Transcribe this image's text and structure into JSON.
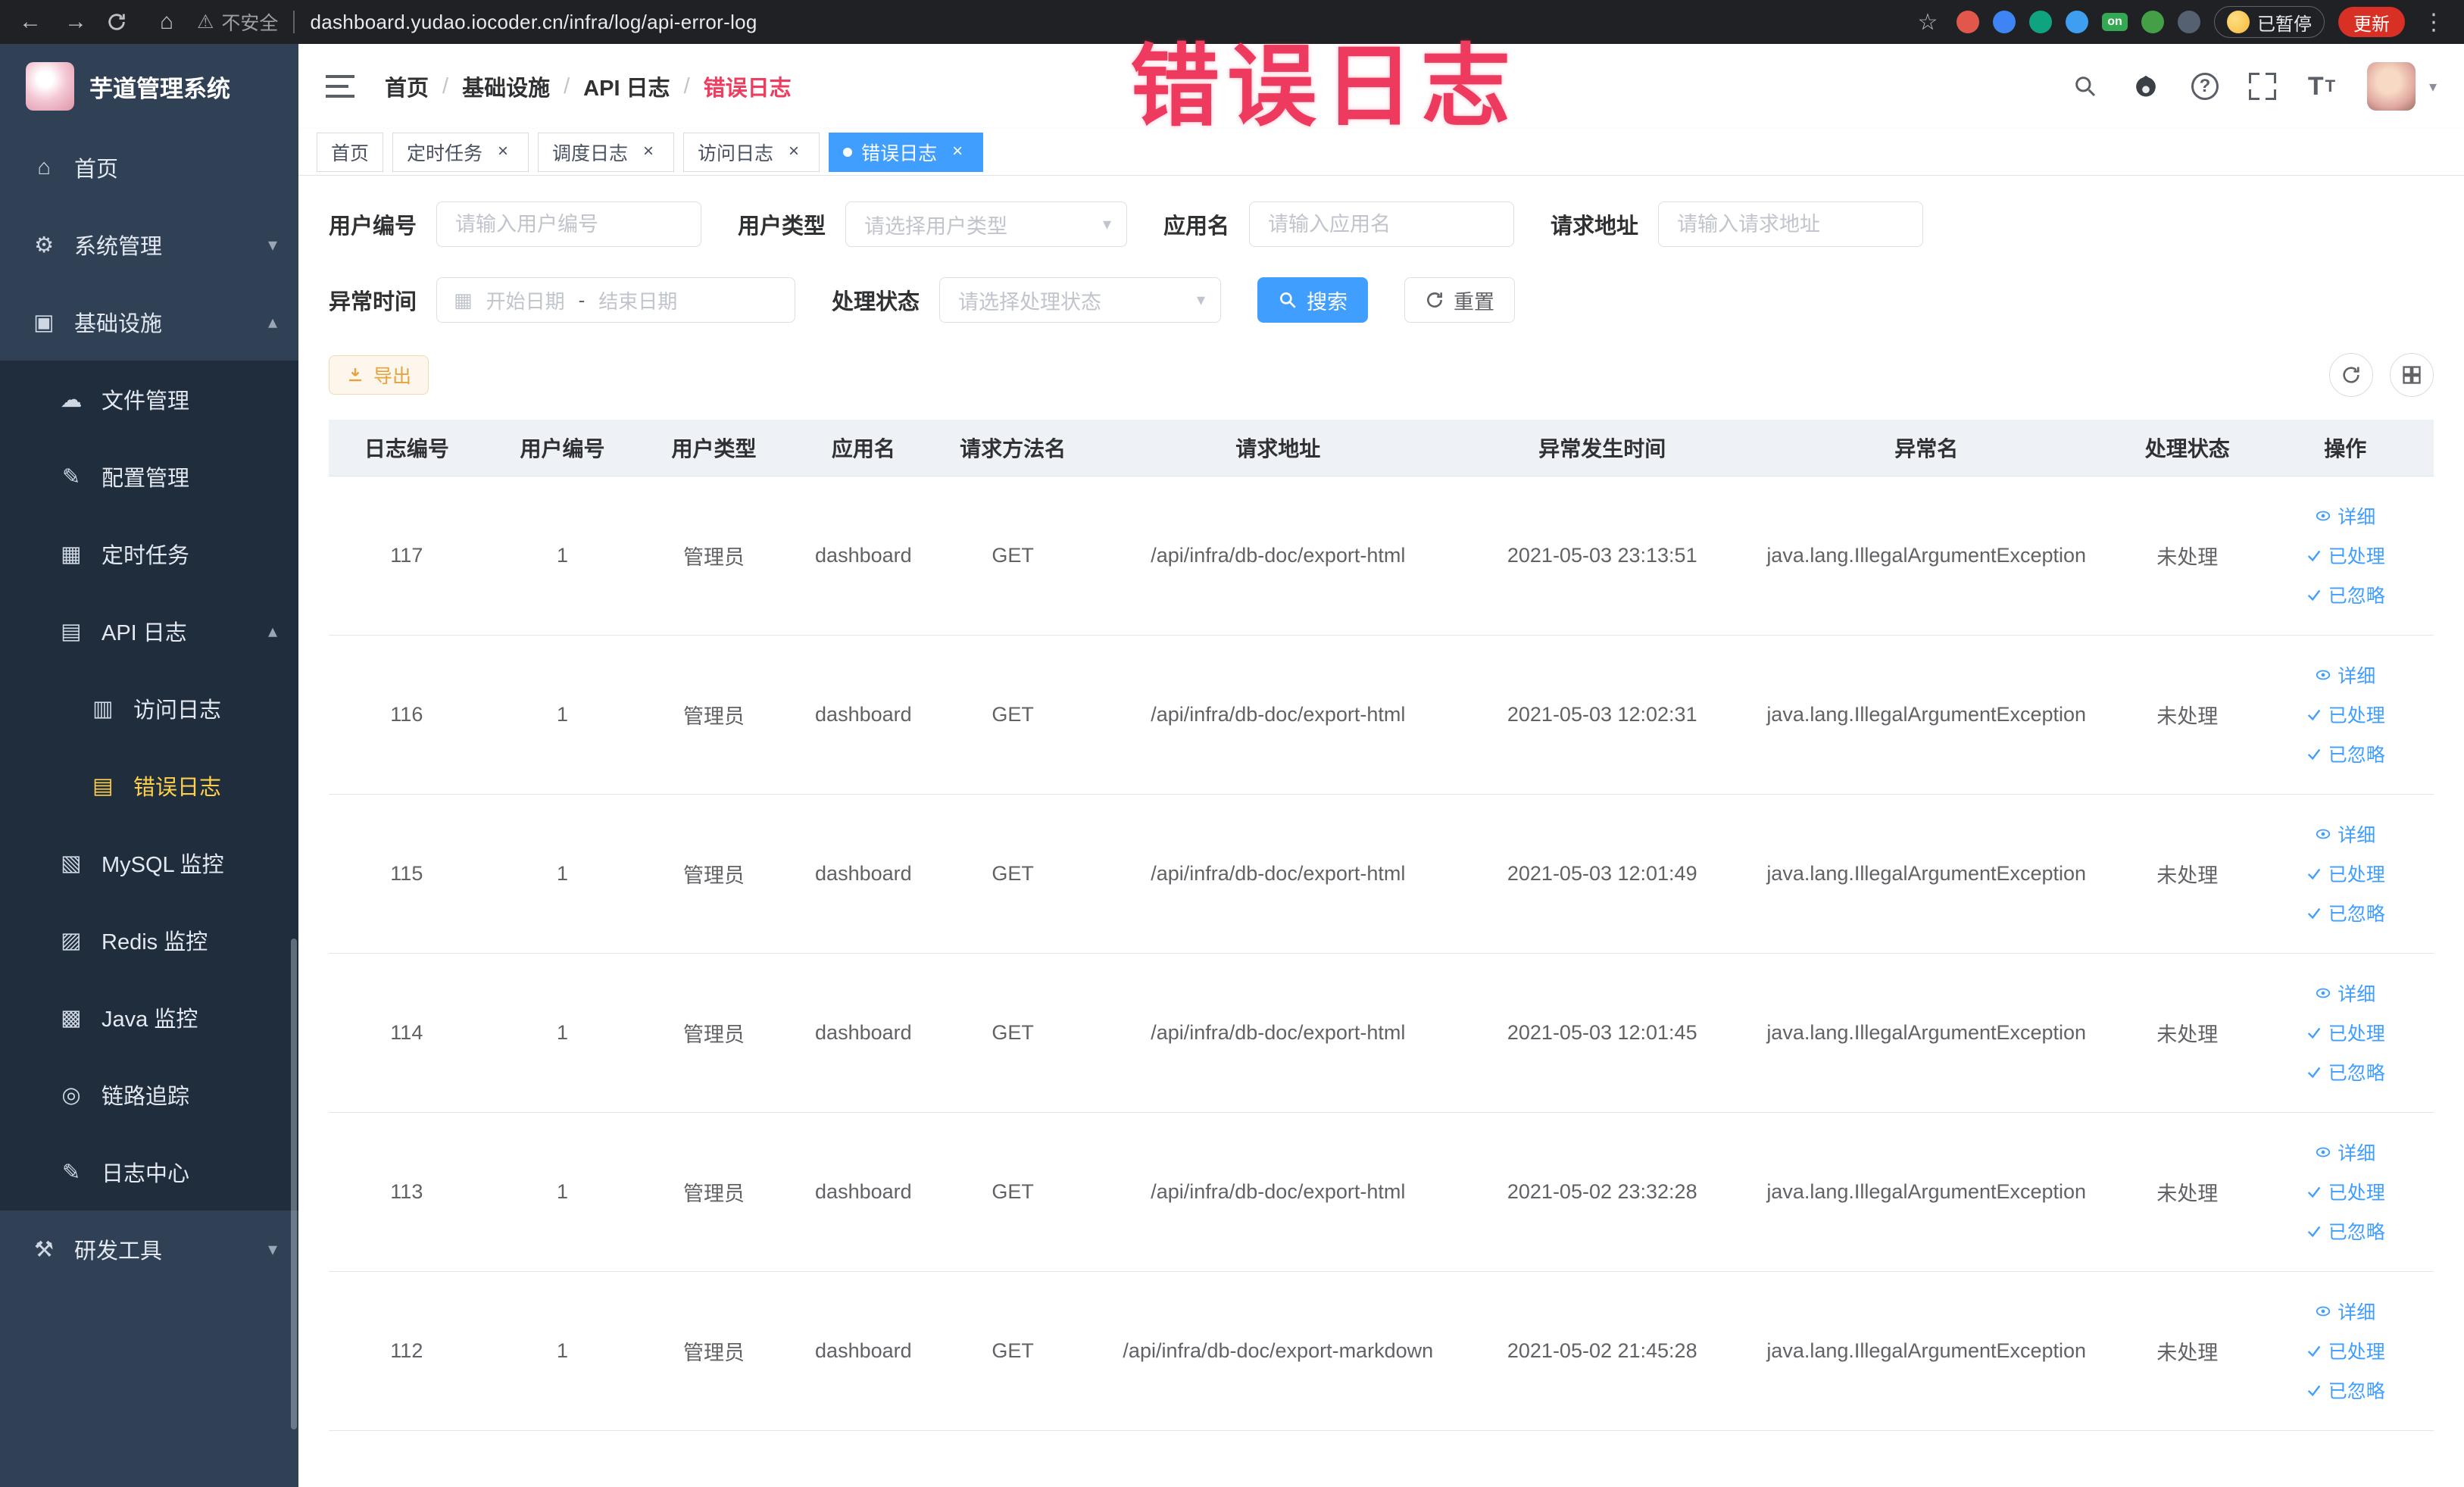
{
  "browser": {
    "security_label": "不安全",
    "url": "dashboard.yudao.iocoder.cn/infra/log/api-error-log",
    "paused_label": "已暂停",
    "update_label": "更新",
    "on_badge": "on"
  },
  "icons": {
    "back": "←",
    "forward": "→",
    "home_chrome": "⌂",
    "warning": "⚠",
    "star": "☆",
    "kebab": "⋮",
    "chevron_down": "▾",
    "chevron_up": "▴",
    "breadcrumb_sep": "/",
    "close": "×",
    "caret_down": "▾",
    "calendar": "▦",
    "question": "?",
    "font_size_large": "T",
    "font_size_small": "T",
    "home": "⌂",
    "system": "⚙",
    "infra": "▣",
    "file": "☁",
    "config": "✎",
    "job": "▦",
    "api_log": "▤",
    "access_log": "▥",
    "error_log": "▤",
    "mysql": "▧",
    "redis": "▨",
    "java": "▩",
    "trace": "◎",
    "log_center": "✎",
    "devtools": "⚒"
  },
  "annotation": {
    "title": "错误日志"
  },
  "sidebar": {
    "logo_title": "芋道管理系统",
    "home": "首页",
    "system": "系统管理",
    "infra": "基础设施",
    "file": "文件管理",
    "config": "配置管理",
    "job": "定时任务",
    "api_log": "API 日志",
    "access_log": "访问日志",
    "error_log": "错误日志",
    "mysql": "MySQL 监控",
    "redis": "Redis 监控",
    "java": "Java 监控",
    "trace": "链路追踪",
    "log_center": "日志中心",
    "devtools": "研发工具"
  },
  "breadcrumb": {
    "items": [
      "首页",
      "基础设施",
      "API 日志",
      "错误日志"
    ]
  },
  "tags": [
    {
      "label": "首页"
    },
    {
      "label": "定时任务"
    },
    {
      "label": "调度日志"
    },
    {
      "label": "访问日志"
    },
    {
      "label": "错误日志"
    }
  ],
  "filters": {
    "user_id": {
      "label": "用户编号",
      "placeholder": "请输入用户编号"
    },
    "user_type": {
      "label": "用户类型",
      "placeholder": "请选择用户类型"
    },
    "app_name": {
      "label": "应用名",
      "placeholder": "请输入应用名"
    },
    "request_url": {
      "label": "请求地址",
      "placeholder": "请输入请求地址"
    },
    "exception_time": {
      "label": "异常时间",
      "start_placeholder": "开始日期",
      "separator": "-",
      "end_placeholder": "结束日期"
    },
    "process_status": {
      "label": "处理状态",
      "placeholder": "请选择处理状态"
    },
    "search_label": "搜索",
    "reset_label": "重置"
  },
  "toolbar": {
    "export_label": "导出"
  },
  "table": {
    "columns": [
      "日志编号",
      "用户编号",
      "用户类型",
      "应用名",
      "请求方法名",
      "请求地址",
      "异常发生时间",
      "异常名",
      "处理状态",
      "操作"
    ],
    "actions": {
      "detail": "详细",
      "processed": "已处理",
      "ignored": "已忽略"
    },
    "rows": [
      {
        "id": "117",
        "user_id": "1",
        "user_type": "管理员",
        "app": "dashboard",
        "method": "GET",
        "url": "/api/infra/db-doc/export-html",
        "time": "2021-05-03 23:13:51",
        "exception": "java.lang.IllegalArgumentException",
        "status": "未处理"
      },
      {
        "id": "116",
        "user_id": "1",
        "user_type": "管理员",
        "app": "dashboard",
        "method": "GET",
        "url": "/api/infra/db-doc/export-html",
        "time": "2021-05-03 12:02:31",
        "exception": "java.lang.IllegalArgumentException",
        "status": "未处理"
      },
      {
        "id": "115",
        "user_id": "1",
        "user_type": "管理员",
        "app": "dashboard",
        "method": "GET",
        "url": "/api/infra/db-doc/export-html",
        "time": "2021-05-03 12:01:49",
        "exception": "java.lang.IllegalArgumentException",
        "status": "未处理"
      },
      {
        "id": "114",
        "user_id": "1",
        "user_type": "管理员",
        "app": "dashboard",
        "method": "GET",
        "url": "/api/infra/db-doc/export-html",
        "time": "2021-05-03 12:01:45",
        "exception": "java.lang.IllegalArgumentException",
        "status": "未处理"
      },
      {
        "id": "113",
        "user_id": "1",
        "user_type": "管理员",
        "app": "dashboard",
        "method": "GET",
        "url": "/api/infra/db-doc/export-html",
        "time": "2021-05-02 23:32:28",
        "exception": "java.lang.IllegalArgumentException",
        "status": "未处理"
      },
      {
        "id": "112",
        "user_id": "1",
        "user_type": "管理员",
        "app": "dashboard",
        "method": "GET",
        "url": "/api/infra/db-doc/export-markdown",
        "time": "2021-05-02 21:45:28",
        "exception": "java.lang.IllegalArgumentException",
        "status": "未处理"
      }
    ]
  }
}
